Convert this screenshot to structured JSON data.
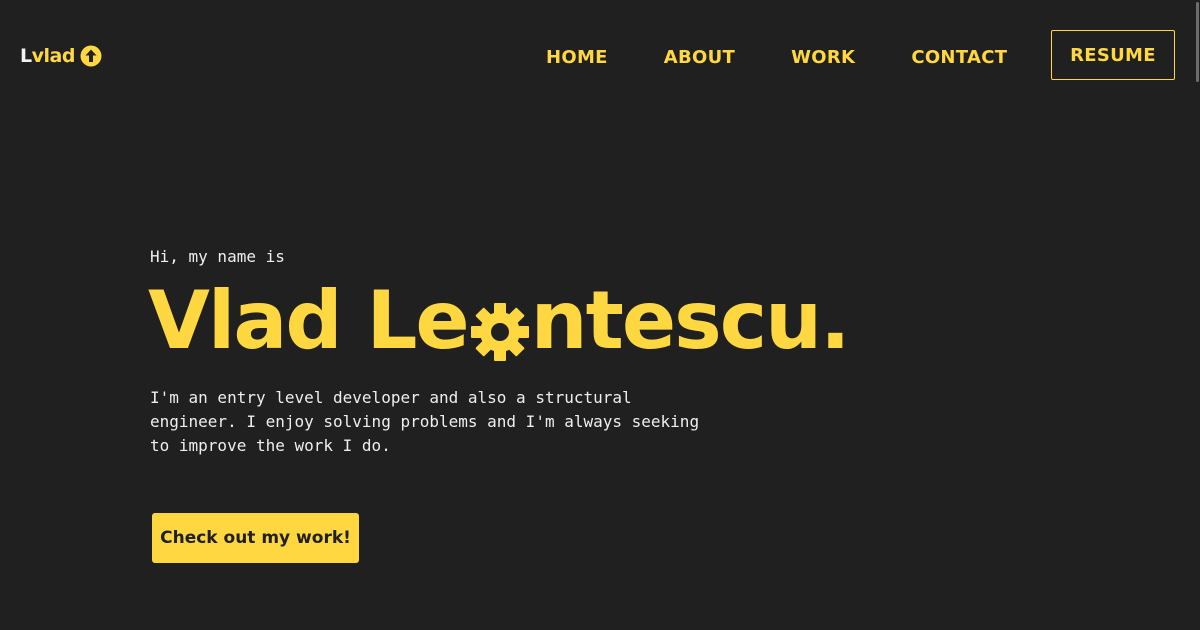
{
  "brand": {
    "logo_prefix": "L",
    "logo_text": "vlad",
    "logo_icon": "arrow-up-circle-icon"
  },
  "nav": {
    "items": [
      {
        "label": "HOME"
      },
      {
        "label": "ABOUT"
      },
      {
        "label": "WORK"
      },
      {
        "label": "CONTACT"
      }
    ],
    "resume_label": "RESUME"
  },
  "hero": {
    "greeting": "Hi, my name is",
    "name_before_icon": "Vlad Le",
    "name_icon": "gear-icon",
    "name_after_icon": "ntescu.",
    "description": "I'm an entry level developer and also a structural engineer. I enjoy solving problems and I'm always seeking to improve the work I do.",
    "cta_label": "Check out my work!"
  },
  "colors": {
    "background": "#202020",
    "accent": "#ffd740",
    "text": "#eeeeee"
  }
}
